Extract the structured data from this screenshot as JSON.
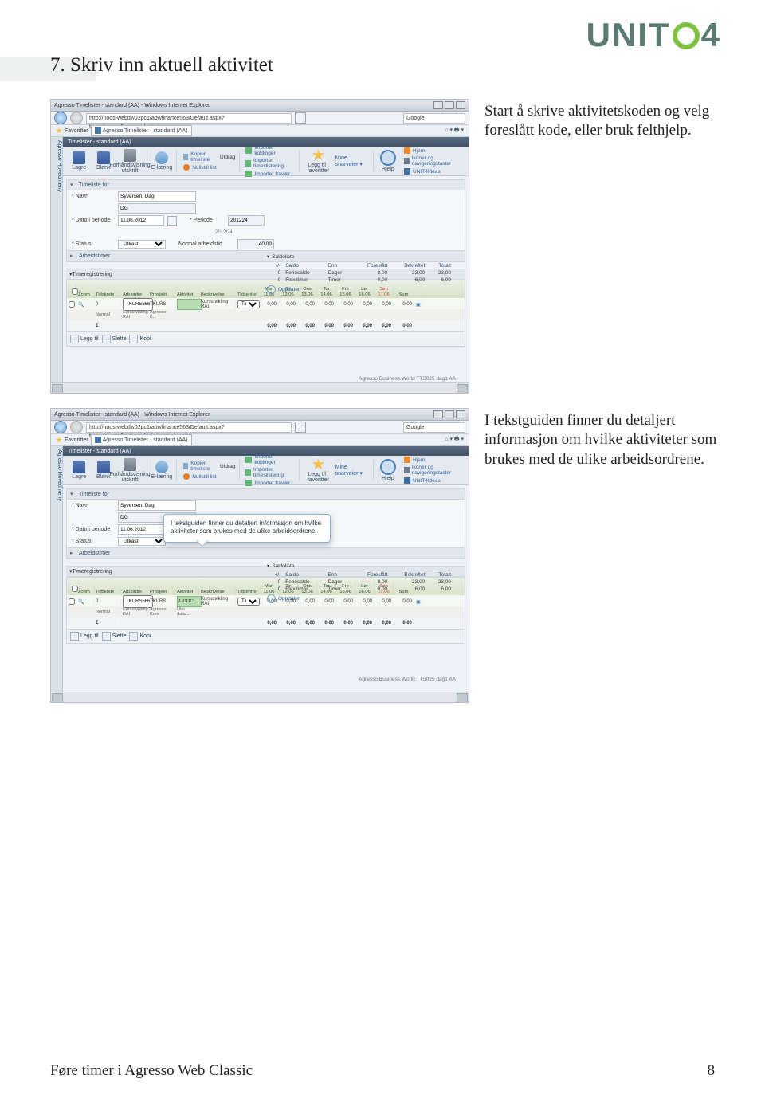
{
  "logo": {
    "pre": "UNIT",
    "post": "4"
  },
  "heading": "7. Skriv inn aktuell aktivitet",
  "instruction1": "Start å skrive aktivitetskoden og velg foreslått kode, eller bruk felthjelp.",
  "instruction2": "I tekstguiden finner du detaljert informasjon om hvilke aktiviteter som brukes med de ulike arbeidsordrene.",
  "screenshot": {
    "ie_title": "Agresso Timelister - standard (AA) - Windows Internet Explorer",
    "url": "http://noos-webdw02pc1/abwfinance563/Default.aspx?type=topgen&menu_id=start",
    "search_label": "Google",
    "fav_label": "Favoritter",
    "fav_tab": "Agresso Timelister - standard (AA)",
    "header_title": "Timelister - standard (AA)",
    "side_label": "Agresso Hovedmeny",
    "toolbar": {
      "save": "Lagre",
      "blank": "Blank",
      "print": "Forhåndsvisning utskrift",
      "elearn": "E-læring",
      "links_col1": {
        "a": "Kopier timeliste",
        "b": "Nullstill list",
        "c": "Utdrag"
      },
      "links_col2": {
        "a": "Importer koblinger",
        "b": "Importer timeslistering",
        "c": "Importer fravær"
      },
      "addfav": "Legg til i favoritter",
      "mine": "Mine snarveier ▾",
      "hjelp": "Hjelp",
      "home": "Hjem",
      "keys": "Ikoner og navigeringstaster",
      "ideas": "UNIT4Ideas"
    },
    "form": {
      "section1": "Timeliste for",
      "navn_lbl": "* Navn",
      "navn_val": "Syversen, Dag",
      "navn_code": "DG",
      "dato_lbl": "* Dato i periode",
      "dato_val": "11.06.2012",
      "periode_lbl": "* Periode",
      "periode_val": "201224",
      "periode_sub": "2012/24",
      "status_lbl": "* Status",
      "status_val": "Utkast",
      "arbeid_lbl": "Normal arbeidstid",
      "arbeid_val": "40,00",
      "arbeidstimer": "Arbeidstimer"
    },
    "balance": {
      "title": "Saldoliste",
      "cols": [
        "+/-",
        "Saldo",
        "Enh",
        "Foreslått",
        "Bekreftet",
        "Totalt"
      ],
      "rows": [
        {
          "name": "Feriesaldo",
          "unit": "Dager",
          "a": "0",
          "b": "8,00",
          "c": "23,00",
          "d": "23,00"
        },
        {
          "name": "Flexitimer",
          "unit": "Timer",
          "a": "0",
          "b": "0,00",
          "c": "6,00",
          "d": "6,00"
        }
      ],
      "update": "Oppdater"
    },
    "grid": {
      "section": "Timeregistrering",
      "cols": {
        "zoom": "Zoom",
        "tid": "Tidskode",
        "ao": "Arb.ordre",
        "pro": "Prosjekt",
        "akt": "Aktivitet",
        "besk": "Beskrivelse",
        "tids": "Tidsenhet",
        "d1": "Man 11.06",
        "d2": "Tir 12.06",
        "d3": "Ons 13.06",
        "d4": "Tor 14.06",
        "d5": "Fre 15.06",
        "d6": "Lør 16.06",
        "d7": "Søn 17.06",
        "sum": "Sum"
      },
      "row": {
        "tid": "0",
        "ao": "TKURS566",
        "pro": "TKURS",
        "akt": "",
        "besk": "Kursutvikling RAI",
        "tids": "Timer",
        "v": [
          "0,00",
          "0,00",
          "0,00",
          "0,00",
          "0,00",
          "0,00",
          "0,00",
          "0,00"
        ]
      },
      "row_sub": {
        "a": "Normal",
        "b": "Kursutvikling RAI",
        "c": "Agresso K..."
      },
      "row_sub2": {
        "a": "Normal",
        "b": "Kursutvikling RAI",
        "c": "Agresso Kurs",
        "d": "Utvi data..."
      },
      "totals": {
        "label": "Σ",
        "v": [
          "0,00",
          "0,00",
          "0,00",
          "0,00",
          "0,00",
          "0,00",
          "0,00",
          "0,00"
        ]
      },
      "actions": {
        "leggtil": "Legg til",
        "slette": "Slette",
        "kopi": "Kopi"
      }
    },
    "statusbar": "Agresso Business World  TTS025  dag1  AA",
    "tooltip_text": "I tekstguiden finner du detaljert informasjon om hvilke aktiviteter som brukes med de ulike arbeidsordrene.",
    "row2_akt": "UDOC"
  },
  "footer": {
    "left": "Føre timer i Agresso Web Classic",
    "page": "8"
  }
}
